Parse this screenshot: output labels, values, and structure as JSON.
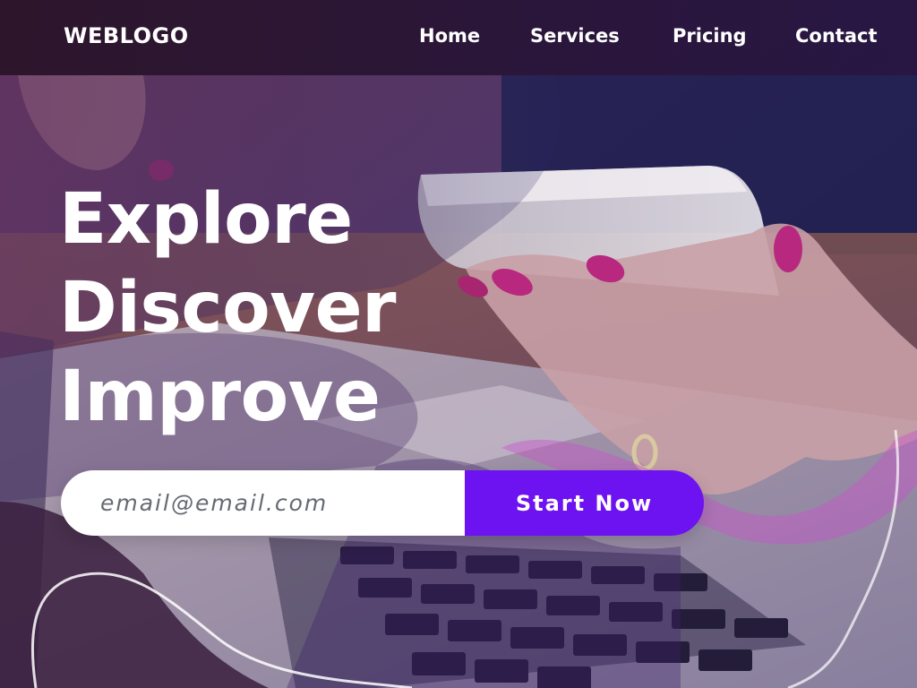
{
  "header": {
    "logo": "WEBLOGO",
    "nav": [
      {
        "label": "Home"
      },
      {
        "label": "Services"
      },
      {
        "label": "Pricing"
      },
      {
        "label": "Contact"
      }
    ]
  },
  "hero": {
    "lines": [
      "Explore",
      "Discover",
      "Improve"
    ]
  },
  "signup": {
    "placeholder": "email@email.com",
    "button": "Start Now"
  },
  "colors": {
    "accent": "#6d12f0",
    "navbar": "#2a1530",
    "text": "#ffffff"
  }
}
